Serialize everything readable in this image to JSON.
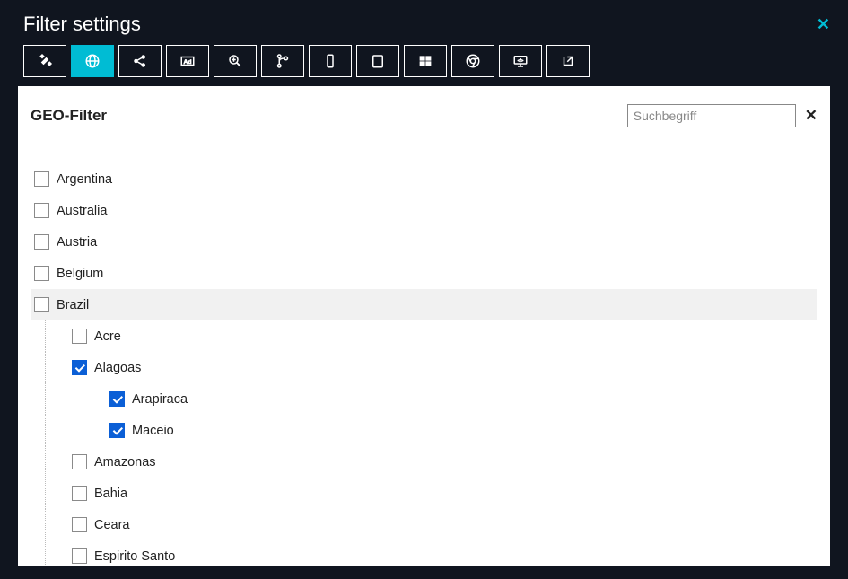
{
  "modal": {
    "title": "Filter settings"
  },
  "panel": {
    "title": "GEO-Filter",
    "search_placeholder": "Suchbegriff"
  },
  "tabs": [
    {
      "id": "puzzle",
      "active": false
    },
    {
      "id": "globe",
      "active": true
    },
    {
      "id": "share",
      "active": false
    },
    {
      "id": "ad",
      "active": false
    },
    {
      "id": "zoom",
      "active": false
    },
    {
      "id": "branch",
      "active": false
    },
    {
      "id": "phone",
      "active": false
    },
    {
      "id": "tablet",
      "active": false
    },
    {
      "id": "windows",
      "active": false
    },
    {
      "id": "chrome",
      "active": false
    },
    {
      "id": "monitor",
      "active": false
    },
    {
      "id": "external",
      "active": false
    }
  ],
  "tree": [
    {
      "label": "Argentina",
      "level": 0,
      "checked": false,
      "highlight": false
    },
    {
      "label": "Australia",
      "level": 0,
      "checked": false,
      "highlight": false
    },
    {
      "label": "Austria",
      "level": 0,
      "checked": false,
      "highlight": false
    },
    {
      "label": "Belgium",
      "level": 0,
      "checked": false,
      "highlight": false
    },
    {
      "label": "Brazil",
      "level": 0,
      "checked": false,
      "highlight": true
    },
    {
      "label": "Acre",
      "level": 1,
      "checked": false,
      "highlight": false
    },
    {
      "label": "Alagoas",
      "level": 1,
      "checked": true,
      "highlight": false
    },
    {
      "label": "Arapiraca",
      "level": 2,
      "checked": true,
      "highlight": false
    },
    {
      "label": "Maceio",
      "level": 2,
      "checked": true,
      "highlight": false
    },
    {
      "label": "Amazonas",
      "level": 1,
      "checked": false,
      "highlight": false
    },
    {
      "label": "Bahia",
      "level": 1,
      "checked": false,
      "highlight": false
    },
    {
      "label": "Ceara",
      "level": 1,
      "checked": false,
      "highlight": false
    },
    {
      "label": "Espirito Santo",
      "level": 1,
      "checked": false,
      "highlight": false
    }
  ],
  "colors": {
    "accent": "#00bcd4",
    "checkbox_checked": "#0b5fd6",
    "background_dark": "#10151f"
  }
}
